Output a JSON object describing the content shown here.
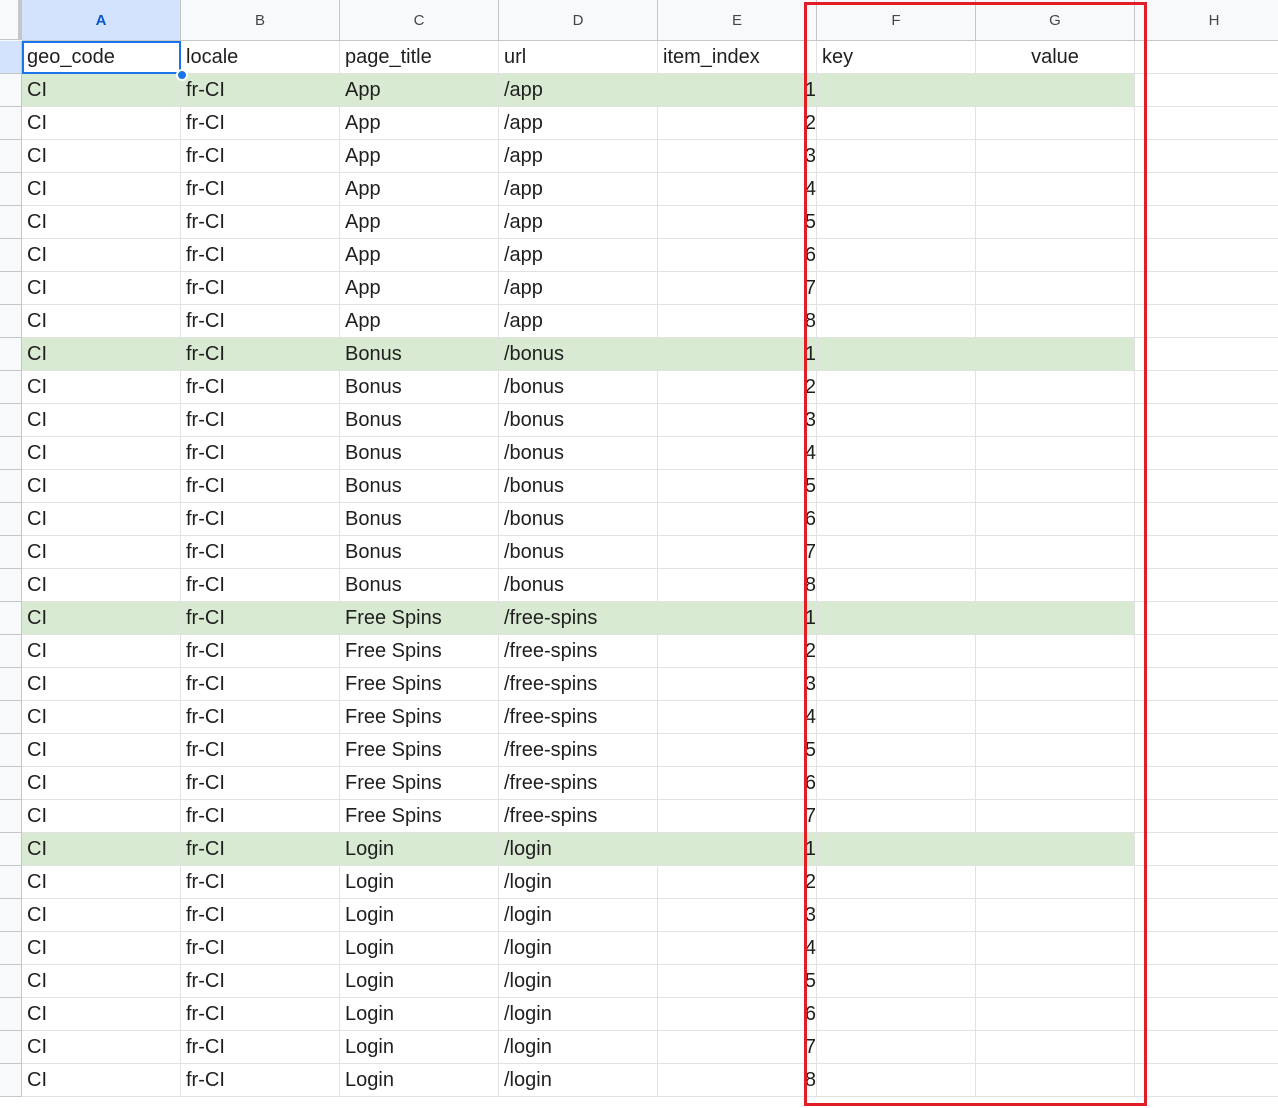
{
  "columns": [
    {
      "letter": "A"
    },
    {
      "letter": "B"
    },
    {
      "letter": "C"
    },
    {
      "letter": "D"
    },
    {
      "letter": "E"
    },
    {
      "letter": "F"
    },
    {
      "letter": "G"
    },
    {
      "letter": "H"
    }
  ],
  "header_row": {
    "geo_code": "geo_code",
    "locale": "locale",
    "page_title": "page_title",
    "url": "url",
    "item_index": "item_index",
    "key": "key",
    "value": "value"
  },
  "rows": [
    {
      "geo": "CI",
      "locale": "fr-CI",
      "title": "App",
      "url": "/app",
      "index": "1",
      "highlighted": true
    },
    {
      "geo": "CI",
      "locale": "fr-CI",
      "title": "App",
      "url": "/app",
      "index": "2",
      "highlighted": false
    },
    {
      "geo": "CI",
      "locale": "fr-CI",
      "title": "App",
      "url": "/app",
      "index": "3",
      "highlighted": false
    },
    {
      "geo": "CI",
      "locale": "fr-CI",
      "title": "App",
      "url": "/app",
      "index": "4",
      "highlighted": false
    },
    {
      "geo": "CI",
      "locale": "fr-CI",
      "title": "App",
      "url": "/app",
      "index": "5",
      "highlighted": false
    },
    {
      "geo": "CI",
      "locale": "fr-CI",
      "title": "App",
      "url": "/app",
      "index": "6",
      "highlighted": false
    },
    {
      "geo": "CI",
      "locale": "fr-CI",
      "title": "App",
      "url": "/app",
      "index": "7",
      "highlighted": false
    },
    {
      "geo": "CI",
      "locale": "fr-CI",
      "title": "App",
      "url": "/app",
      "index": "8",
      "highlighted": false
    },
    {
      "geo": "CI",
      "locale": "fr-CI",
      "title": "Bonus",
      "url": "/bonus",
      "index": "1",
      "highlighted": true
    },
    {
      "geo": "CI",
      "locale": "fr-CI",
      "title": "Bonus",
      "url": "/bonus",
      "index": "2",
      "highlighted": false
    },
    {
      "geo": "CI",
      "locale": "fr-CI",
      "title": "Bonus",
      "url": "/bonus",
      "index": "3",
      "highlighted": false
    },
    {
      "geo": "CI",
      "locale": "fr-CI",
      "title": "Bonus",
      "url": "/bonus",
      "index": "4",
      "highlighted": false
    },
    {
      "geo": "CI",
      "locale": "fr-CI",
      "title": "Bonus",
      "url": "/bonus",
      "index": "5",
      "highlighted": false
    },
    {
      "geo": "CI",
      "locale": "fr-CI",
      "title": "Bonus",
      "url": "/bonus",
      "index": "6",
      "highlighted": false
    },
    {
      "geo": "CI",
      "locale": "fr-CI",
      "title": "Bonus",
      "url": "/bonus",
      "index": "7",
      "highlighted": false
    },
    {
      "geo": "CI",
      "locale": "fr-CI",
      "title": "Bonus",
      "url": "/bonus",
      "index": "8",
      "highlighted": false
    },
    {
      "geo": "CI",
      "locale": "fr-CI",
      "title": "Free Spins",
      "url": "/free-spins",
      "index": "1",
      "highlighted": true
    },
    {
      "geo": "CI",
      "locale": "fr-CI",
      "title": "Free Spins",
      "url": "/free-spins",
      "index": "2",
      "highlighted": false
    },
    {
      "geo": "CI",
      "locale": "fr-CI",
      "title": "Free Spins",
      "url": "/free-spins",
      "index": "3",
      "highlighted": false
    },
    {
      "geo": "CI",
      "locale": "fr-CI",
      "title": "Free Spins",
      "url": "/free-spins",
      "index": "4",
      "highlighted": false
    },
    {
      "geo": "CI",
      "locale": "fr-CI",
      "title": "Free Spins",
      "url": "/free-spins",
      "index": "5",
      "highlighted": false
    },
    {
      "geo": "CI",
      "locale": "fr-CI",
      "title": "Free Spins",
      "url": "/free-spins",
      "index": "6",
      "highlighted": false
    },
    {
      "geo": "CI",
      "locale": "fr-CI",
      "title": "Free Spins",
      "url": "/free-spins",
      "index": "7",
      "highlighted": false
    },
    {
      "geo": "CI",
      "locale": "fr-CI",
      "title": "Login",
      "url": "/login",
      "index": "1",
      "highlighted": true
    },
    {
      "geo": "CI",
      "locale": "fr-CI",
      "title": "Login",
      "url": "/login",
      "index": "2",
      "highlighted": false
    },
    {
      "geo": "CI",
      "locale": "fr-CI",
      "title": "Login",
      "url": "/login",
      "index": "3",
      "highlighted": false
    },
    {
      "geo": "CI",
      "locale": "fr-CI",
      "title": "Login",
      "url": "/login",
      "index": "4",
      "highlighted": false
    },
    {
      "geo": "CI",
      "locale": "fr-CI",
      "title": "Login",
      "url": "/login",
      "index": "5",
      "highlighted": false
    },
    {
      "geo": "CI",
      "locale": "fr-CI",
      "title": "Login",
      "url": "/login",
      "index": "6",
      "highlighted": false
    },
    {
      "geo": "CI",
      "locale": "fr-CI",
      "title": "Login",
      "url": "/login",
      "index": "7",
      "highlighted": false
    },
    {
      "geo": "CI",
      "locale": "fr-CI",
      "title": "Login",
      "url": "/login",
      "index": "8",
      "highlighted": false
    }
  ],
  "colors": {
    "row_highlight": "#d9ead3",
    "selection_blue": "#1a73e8",
    "annotation_red": "#e11d25",
    "header_bg": "#f8f9fa"
  }
}
